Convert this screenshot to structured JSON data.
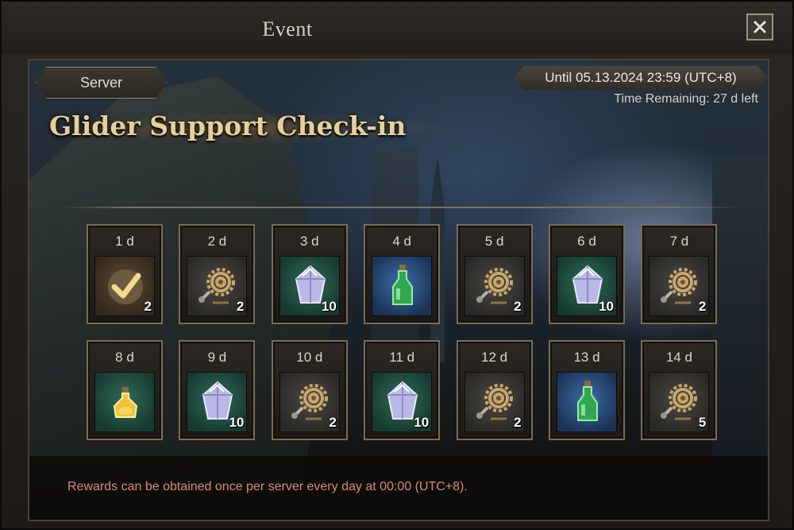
{
  "window": {
    "title": "Event",
    "close_icon": "close-icon"
  },
  "server_tab": {
    "label": "Server"
  },
  "event": {
    "title": "Glider Support Check-in",
    "period": "Until 05.13.2024 23:59 (UTC+8)",
    "time_remaining": "Time Remaining: 27 d left"
  },
  "rewards": [
    {
      "day": "1 d",
      "qty": "2",
      "icon": "checkmark-icon",
      "claimed": true
    },
    {
      "day": "2 d",
      "qty": "2",
      "icon": "gear-icon"
    },
    {
      "day": "3 d",
      "qty": "10",
      "icon": "crystal-icon"
    },
    {
      "day": "4 d",
      "qty": "",
      "icon": "green-potion-icon"
    },
    {
      "day": "5 d",
      "qty": "2",
      "icon": "gear-icon"
    },
    {
      "day": "6 d",
      "qty": "10",
      "icon": "crystal-icon"
    },
    {
      "day": "7 d",
      "qty": "2",
      "icon": "gear-icon"
    },
    {
      "day": "8 d",
      "qty": "",
      "icon": "yellow-potion-icon"
    },
    {
      "day": "9 d",
      "qty": "10",
      "icon": "crystal-icon"
    },
    {
      "day": "10 d",
      "qty": "2",
      "icon": "gear-icon"
    },
    {
      "day": "11 d",
      "qty": "10",
      "icon": "crystal-icon"
    },
    {
      "day": "12 d",
      "qty": "2",
      "icon": "gear-icon"
    },
    {
      "day": "13 d",
      "qty": "",
      "icon": "green-potion-icon"
    },
    {
      "day": "14 d",
      "qty": "5",
      "icon": "gear-icon"
    }
  ],
  "footer": {
    "note": "Rewards can be obtained once per server every day at 00:00 (UTC+8)."
  },
  "colors": {
    "title_gold": "#e6cf98",
    "note_red": "#d9897a",
    "slot_border": "#7b6c52"
  }
}
